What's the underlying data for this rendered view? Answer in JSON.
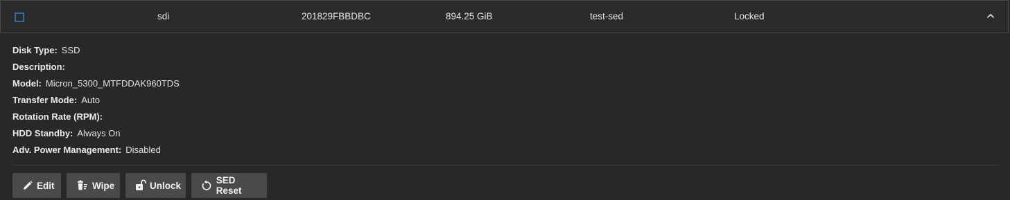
{
  "disk": {
    "name": "sdi",
    "serial": "201829FBBDBC",
    "size": "894.25 GiB",
    "pool": "test-sed",
    "status": "Locked"
  },
  "details": [
    {
      "label": "Disk Type:",
      "value": "SSD"
    },
    {
      "label": "Description:",
      "value": ""
    },
    {
      "label": "Model:",
      "value": "Micron_5300_MTFDDAK960TDS"
    },
    {
      "label": "Transfer Mode:",
      "value": "Auto"
    },
    {
      "label": "Rotation Rate (RPM):",
      "value": ""
    },
    {
      "label": "HDD Standby:",
      "value": "Always On"
    },
    {
      "label": "Adv. Power Management:",
      "value": "Disabled"
    }
  ],
  "actions": [
    {
      "label": "Edit",
      "icon": "pencil-icon"
    },
    {
      "label": "Wipe",
      "icon": "wipe-icon"
    },
    {
      "label": "Unlock",
      "icon": "unlock-icon"
    },
    {
      "label": "SED Reset",
      "icon": "reset-icon"
    }
  ],
  "colors": {
    "background": "#282828",
    "checkbox_border": "#2e6a9e",
    "button_bg": "#4a4a4a"
  }
}
